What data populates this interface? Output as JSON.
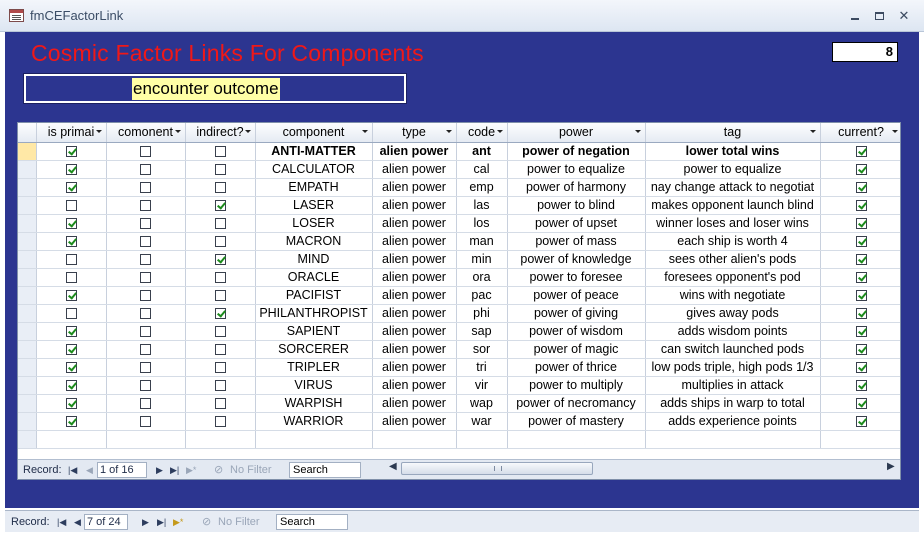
{
  "window": {
    "title": "fmCEFactorLink"
  },
  "form": {
    "title": "Cosmic Factor Links For Components",
    "count": "8",
    "factor_name": "encounter outcome"
  },
  "columns": [
    "is primai",
    "comonent",
    "indirect?",
    "component",
    "type",
    "code",
    "power",
    "tag",
    "current?"
  ],
  "rows": [
    {
      "primary": true,
      "comonent": false,
      "indirect": false,
      "component": "ANTI-MATTER",
      "type": "alien power",
      "code": "ant",
      "power": "power of negation",
      "tag": "lower total wins",
      "current": true
    },
    {
      "primary": true,
      "comonent": false,
      "indirect": false,
      "component": "CALCULATOR",
      "type": "alien power",
      "code": "cal",
      "power": "power to equalize",
      "tag": "power to equalize",
      "current": true
    },
    {
      "primary": true,
      "comonent": false,
      "indirect": false,
      "component": "EMPATH",
      "type": "alien power",
      "code": "emp",
      "power": "power of harmony",
      "tag": "nay change attack to negotiat",
      "current": true
    },
    {
      "primary": false,
      "comonent": false,
      "indirect": true,
      "component": "LASER",
      "type": "alien power",
      "code": "las",
      "power": "power to blind",
      "tag": "makes opponent launch blind",
      "current": true
    },
    {
      "primary": true,
      "comonent": false,
      "indirect": false,
      "component": "LOSER",
      "type": "alien power",
      "code": "los",
      "power": "power of upset",
      "tag": "winner loses and loser wins",
      "current": true
    },
    {
      "primary": true,
      "comonent": false,
      "indirect": false,
      "component": "MACRON",
      "type": "alien power",
      "code": "man",
      "power": "power of mass",
      "tag": "each ship is worth 4",
      "current": true
    },
    {
      "primary": false,
      "comonent": false,
      "indirect": true,
      "component": "MIND",
      "type": "alien power",
      "code": "min",
      "power": "power of knowledge",
      "tag": "sees other alien's pods",
      "current": true
    },
    {
      "primary": false,
      "comonent": false,
      "indirect": false,
      "component": "ORACLE",
      "type": "alien power",
      "code": "ora",
      "power": "power to foresee",
      "tag": "foresees opponent's pod",
      "current": true
    },
    {
      "primary": true,
      "comonent": false,
      "indirect": false,
      "component": "PACIFIST",
      "type": "alien power",
      "code": "pac",
      "power": "power of peace",
      "tag": "wins with negotiate",
      "current": true
    },
    {
      "primary": false,
      "comonent": false,
      "indirect": true,
      "component": "PHILANTHROPIST",
      "type": "alien power",
      "code": "phi",
      "power": "power of giving",
      "tag": "gives away pods",
      "current": true
    },
    {
      "primary": true,
      "comonent": false,
      "indirect": false,
      "component": "SAPIENT",
      "type": "alien power",
      "code": "sap",
      "power": "power of wisdom",
      "tag": "adds wisdom points",
      "current": true
    },
    {
      "primary": true,
      "comonent": false,
      "indirect": false,
      "component": "SORCERER",
      "type": "alien power",
      "code": "sor",
      "power": "power of magic",
      "tag": "can switch launched pods",
      "current": true
    },
    {
      "primary": true,
      "comonent": false,
      "indirect": false,
      "component": "TRIPLER",
      "type": "alien power",
      "code": "tri",
      "power": "power of thrice",
      "tag": "low pods triple,  high pods 1/3",
      "current": true
    },
    {
      "primary": true,
      "comonent": false,
      "indirect": false,
      "component": "VIRUS",
      "type": "alien power",
      "code": "vir",
      "power": "power to multiply",
      "tag": "multiplies in attack",
      "current": true
    },
    {
      "primary": true,
      "comonent": false,
      "indirect": false,
      "component": "WARPISH",
      "type": "alien power",
      "code": "wap",
      "power": "power of necromancy",
      "tag": "adds ships in warp to total",
      "current": true
    },
    {
      "primary": true,
      "comonent": false,
      "indirect": false,
      "component": "WARRIOR",
      "type": "alien power",
      "code": "war",
      "power": "power of mastery",
      "tag": "adds experience points",
      "current": true
    }
  ],
  "subform_nav": {
    "label": "Record:",
    "position": "1 of 16",
    "filter": "No Filter",
    "search": "Search"
  },
  "main_nav": {
    "label": "Record:",
    "position": "7 of 24",
    "filter": "No Filter",
    "search": "Search"
  },
  "colors": {
    "form_bg": "#2c3590",
    "title_red": "#f01818",
    "highlight": "#ffffa6"
  }
}
